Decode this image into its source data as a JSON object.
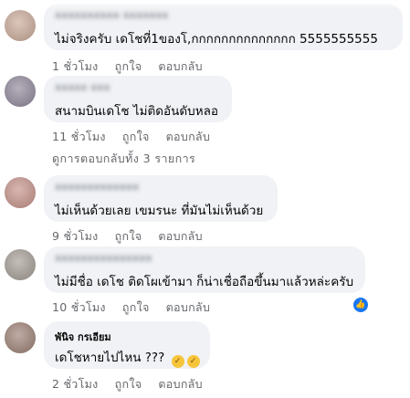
{
  "comments": [
    {
      "author": "xxxxxxxxxx xxxxxxx",
      "text": "ไม่จริงครับ เดโชที่1ของโ,กกกกกกกกกกกกกก 5555555555",
      "time": "1 ชั่วโมง",
      "like": "ถูกใจ",
      "reply": "ตอบกลับ"
    },
    {
      "author": "xxxxx xxx",
      "text": "สนามบินเดโช ไม่ติดอันดับหลอ",
      "time": "11 ชั่วโมง",
      "like": "ถูกใจ",
      "reply": "ตอบกลับ"
    },
    {
      "author": "xxxxxxxxxxxxx",
      "text": "ไม่เห็นด้วยเลย เขมรนะ ที่มันไม่เห็นด้วย",
      "time": "9 ชั่วโมง",
      "like": "ถูกใจ",
      "reply": "ตอบกลับ"
    },
    {
      "author": "xxxxxxxxxxxxxxx",
      "text": "ไม่มีชื่อ เดโช ติดโผเข้ามา ก็น่าเชื่อถือขึ้นมาแล้วหล่ะครับ",
      "time": "10 ชั่วโมง",
      "like": "ถูกใจ",
      "reply": "ตอบกลับ"
    },
    {
      "author": "พันิจ กรเอียม",
      "text": "เดโชหายไปไหน ???",
      "time": "2 ชั่วโมง",
      "like": "ถูกใจ",
      "reply": "ตอบกลับ"
    }
  ],
  "view_replies": "ดูการตอบกลับทั้ง 3 รายการ",
  "colors": {
    "bubble": "#f0f2f5",
    "meta": "#65676b",
    "like_badge": "#1877f2",
    "emoji": "#f7c53a"
  },
  "icons": {
    "reaction": "like-thumb-icon",
    "emoji": "laughing-emoji-icon"
  }
}
